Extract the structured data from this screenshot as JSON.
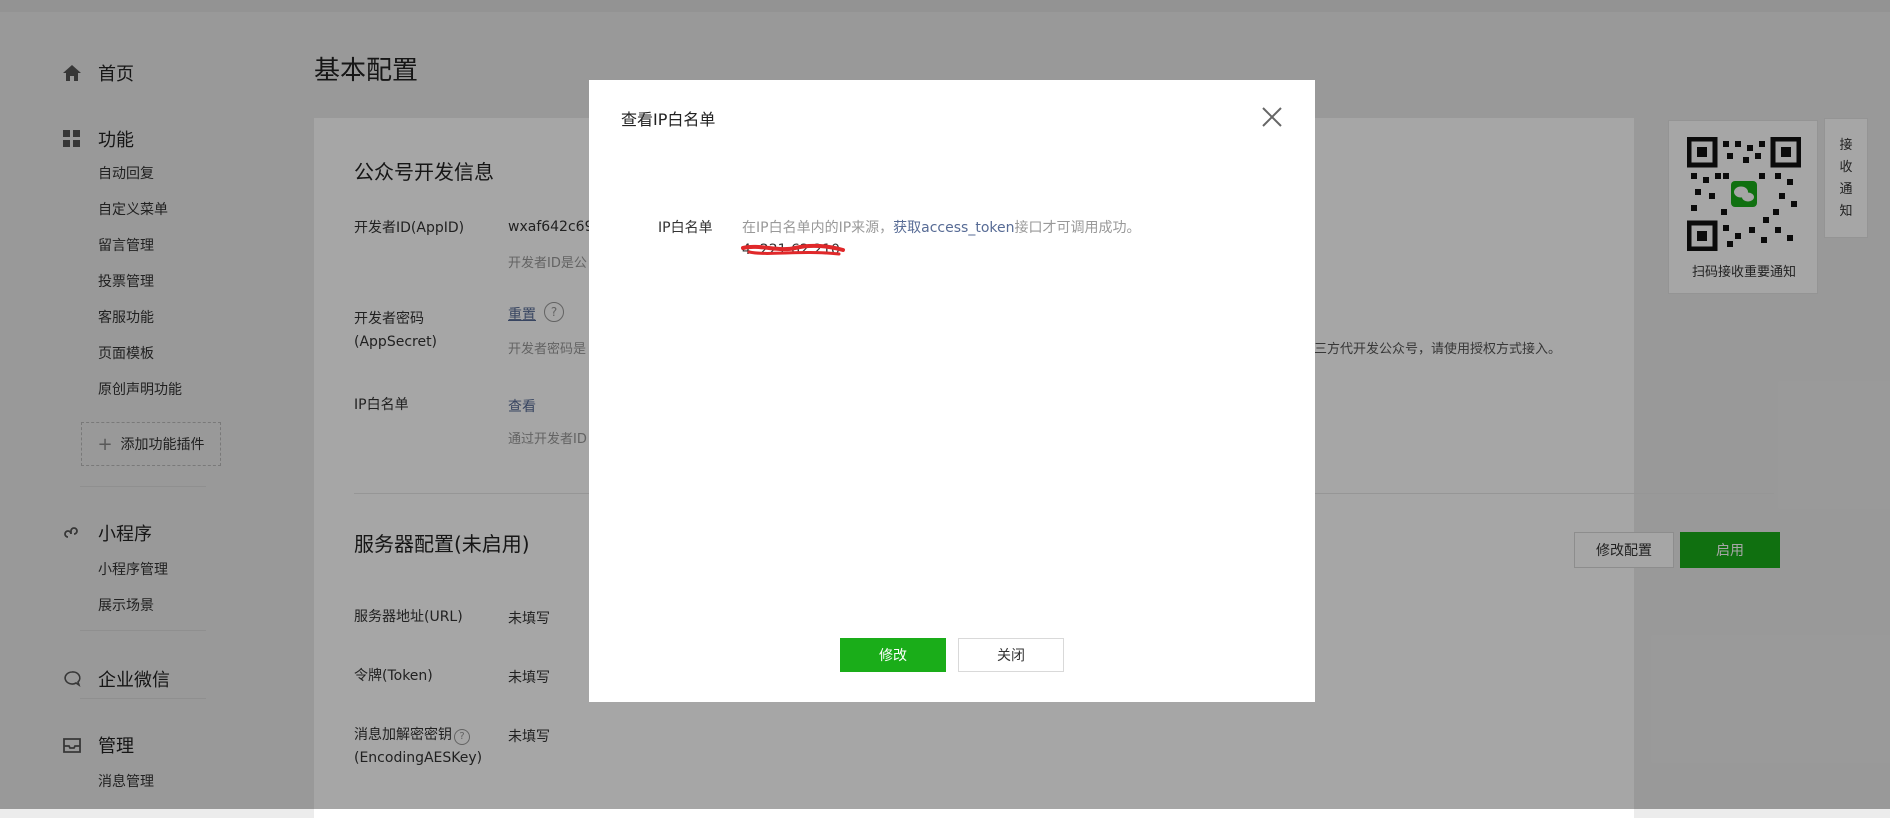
{
  "colors": {
    "brand_green": "#1aad19",
    "link": "#576b95",
    "annotation_red": "#e0282a"
  },
  "sidebar": {
    "home": {
      "icon": "home-icon",
      "label": "首页"
    },
    "features": {
      "icon": "grid-icon",
      "label": "功能",
      "items": [
        "自动回复",
        "自定义菜单",
        "留言管理",
        "投票管理",
        "客服功能",
        "页面模板",
        "原创声明功能"
      ],
      "add_plugin": "添加功能插件"
    },
    "mini_program": {
      "icon": "miniprogram-icon",
      "label": "小程序",
      "items": [
        "小程序管理",
        "展示场景"
      ]
    },
    "wecom": {
      "icon": "wecom-icon",
      "label": "企业微信"
    },
    "manage": {
      "icon": "inbox-icon",
      "label": "管理",
      "items": [
        "消息管理"
      ]
    }
  },
  "main": {
    "page_title": "基本配置",
    "dev_info": {
      "title": "公众号开发信息",
      "appid_label": "开发者ID(AppID)",
      "appid_value": "wxaf642c69",
      "appid_hint": "开发者ID是公",
      "secret_label": "开发者密码",
      "secret_label_2": "(AppSecret)",
      "secret_reset": "重置",
      "secret_hint": "开发者密码是",
      "secret_hint_tail": "三方代开发公众号，请使用授权方式接入。",
      "ip_label": "IP白名单",
      "ip_view": "查看",
      "ip_hint": "通过开发者ID"
    },
    "server": {
      "title": "服务器配置(未启用)",
      "modify_button": "修改配置",
      "enable_button": "启用",
      "url_label": "服务器地址(URL)",
      "url_value": "未填写",
      "token_label": "令牌(Token)",
      "token_value": "未填写",
      "aes_label": "消息加解密密钥",
      "aes_label_2": "(EncodingAESKey)",
      "aes_value": "未填写"
    }
  },
  "qr": {
    "caption": "扫码接收重要通知"
  },
  "notify_tab": {
    "chars": [
      "接",
      "收",
      "通",
      "知"
    ]
  },
  "modal": {
    "title": "查看IP白名单",
    "label": "IP白名单",
    "desc_prefix": "在IP白名单内的IP来源，",
    "desc_link": "获取access_token",
    "desc_suffix": "接口才可调用成功。",
    "ip_value": "4 .221.62.210",
    "modify_button": "修改",
    "close_button": "关闭"
  }
}
